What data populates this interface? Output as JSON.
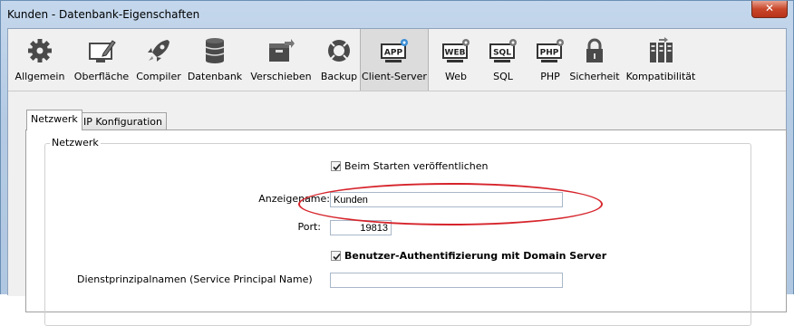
{
  "window": {
    "title": "Kunden - Datenbank-Eigenschaften",
    "close_glyph": "✕"
  },
  "toolbar": {
    "items": [
      {
        "label": "Allgemein",
        "icon": "gear-icon"
      },
      {
        "label": "Oberfläche",
        "icon": "pencil-monitor-icon"
      },
      {
        "label": "Compiler",
        "icon": "rocket-icon"
      },
      {
        "label": "Datenbank",
        "icon": "database-icon"
      },
      {
        "label": "Verschieben",
        "icon": "move-box-icon"
      },
      {
        "label": "Backup",
        "icon": "lifebuoy-icon"
      },
      {
        "label": "Client-Server",
        "icon": "app-server-icon",
        "icon_text": "APP",
        "active": true
      },
      {
        "label": "Web",
        "icon": "web-icon",
        "icon_text": "WEB"
      },
      {
        "label": "SQL",
        "icon": "sql-icon",
        "icon_text": "SQL"
      },
      {
        "label": "PHP",
        "icon": "php-icon",
        "icon_text": "PHP"
      },
      {
        "label": "Sicherheit",
        "icon": "padlock-icon"
      },
      {
        "label": "Kompatibilität",
        "icon": "compatibility-icon"
      }
    ]
  },
  "tabs": [
    {
      "label": "Netzwerk",
      "selected": true
    },
    {
      "label": "IP Konfiguration",
      "selected": false
    }
  ],
  "network": {
    "group_label": "Netzwerk",
    "publish_on_start": {
      "label": "Beim Starten veröffentlichen",
      "checked": true
    },
    "display_name": {
      "label": "Anzeigename:",
      "value": "Kunden"
    },
    "port": {
      "label": "Port:",
      "value": "19813"
    },
    "domain_auth": {
      "label": "Benutzer-Authentifizierung mit Domain Server",
      "checked": true
    },
    "spn": {
      "label": "Dienstprinzipalnamen (Service Principal Name)",
      "value": ""
    }
  },
  "colors": {
    "highlight_ellipse": "#d6242b",
    "active_tab_bg": "#dcdcdc"
  }
}
